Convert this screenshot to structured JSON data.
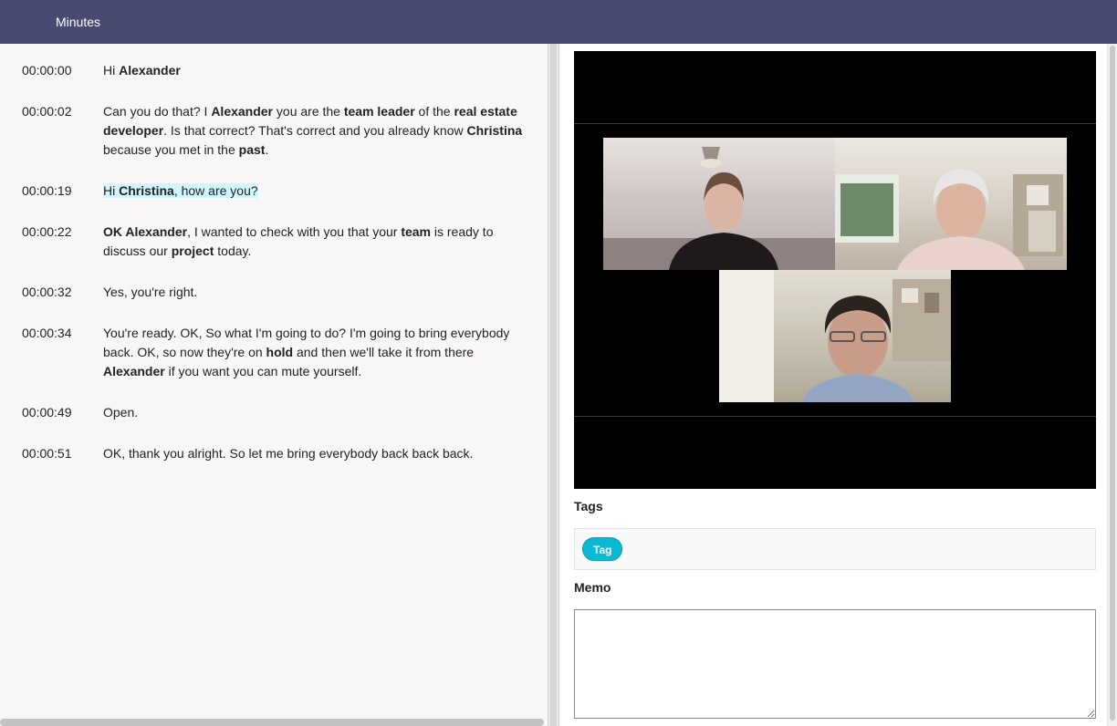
{
  "header": {
    "title": "Minutes"
  },
  "transcript": [
    {
      "time": "00:00:00",
      "highlight": false,
      "segments": [
        {
          "t": "Hi ",
          "b": false
        },
        {
          "t": "Alexander",
          "b": true
        }
      ]
    },
    {
      "time": "00:00:02",
      "highlight": false,
      "segments": [
        {
          "t": "Can you do that? I ",
          "b": false
        },
        {
          "t": "Alexander",
          "b": true
        },
        {
          "t": " you are the ",
          "b": false
        },
        {
          "t": "team leader",
          "b": true
        },
        {
          "t": " of the ",
          "b": false
        },
        {
          "t": "real estate developer",
          "b": true
        },
        {
          "t": ". Is that correct? That's correct and you already know ",
          "b": false
        },
        {
          "t": "Christina",
          "b": true
        },
        {
          "t": " because you met in the ",
          "b": false
        },
        {
          "t": "past",
          "b": true
        },
        {
          "t": ".",
          "b": false
        }
      ]
    },
    {
      "time": "00:00:19",
      "highlight": true,
      "segments": [
        {
          "t": "Hi ",
          "b": false
        },
        {
          "t": "Christina",
          "b": true
        },
        {
          "t": ", how are you?",
          "b": false
        }
      ]
    },
    {
      "time": "00:00:22",
      "highlight": false,
      "segments": [
        {
          "t": "OK Alexander",
          "b": true
        },
        {
          "t": ", I wanted to check with you that your ",
          "b": false
        },
        {
          "t": "team",
          "b": true
        },
        {
          "t": " is ready to discuss our ",
          "b": false
        },
        {
          "t": "project",
          "b": true
        },
        {
          "t": " today.",
          "b": false
        }
      ]
    },
    {
      "time": "00:00:32",
      "highlight": false,
      "segments": [
        {
          "t": "Yes, you're right.",
          "b": false
        }
      ]
    },
    {
      "time": "00:00:34",
      "highlight": false,
      "segments": [
        {
          "t": "You're ready. OK, So what I'm going to do? I'm going to bring everybody back. OK, so now they're on ",
          "b": false
        },
        {
          "t": "hold",
          "b": true
        },
        {
          "t": " and then we'll take it from there ",
          "b": false
        },
        {
          "t": "Alexander",
          "b": true
        },
        {
          "t": " if you want you can mute yourself.",
          "b": false
        }
      ]
    },
    {
      "time": "00:00:49",
      "highlight": false,
      "segments": [
        {
          "t": "Open.",
          "b": false
        }
      ]
    },
    {
      "time": "00:00:51",
      "highlight": false,
      "segments": [
        {
          "t": "OK, thank you alright. So let me bring everybody back back back.",
          "b": false
        }
      ]
    }
  ],
  "tags": {
    "label": "Tags",
    "items": [
      "Tag"
    ]
  },
  "memo": {
    "label": "Memo",
    "value": ""
  },
  "colors": {
    "header_bg": "#484a72",
    "tag_bg": "#0ab9d4",
    "highlight_bg": "#d2f4fb"
  }
}
